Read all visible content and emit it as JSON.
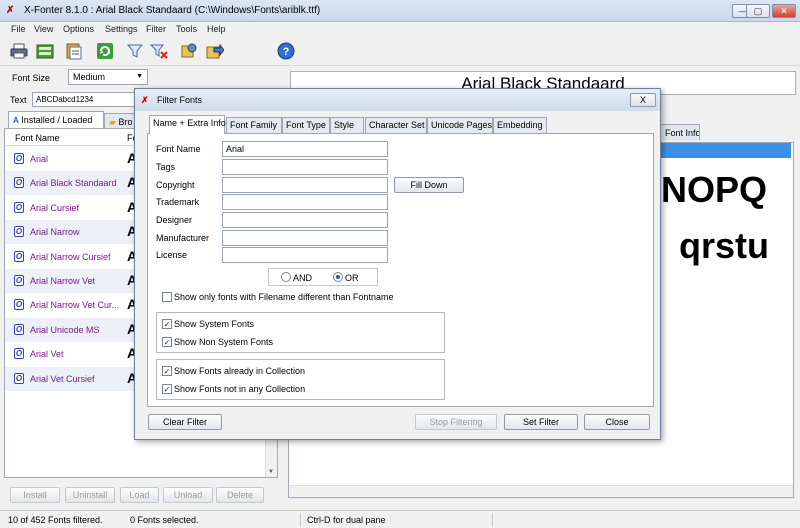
{
  "window": {
    "title": "X-Fonter 8.1.0  :  Arial Black Standaard (C:\\Windows\\Fonts\\ariblk.ttf)",
    "app_icon": "xfonter-logo-icon",
    "min_icon": "minimize-icon",
    "max_icon": "maximize-icon",
    "close_icon": "close-icon"
  },
  "menu": [
    "File",
    "View",
    "Options",
    "Settings",
    "Filter",
    "Tools",
    "Help"
  ],
  "toolbar": {
    "icons": [
      "printer-icon",
      "collection-icon",
      "clipboard-icon",
      "refresh-icon",
      "filter-icon",
      "clear-filter-icon",
      "install-icon",
      "export-icon",
      "help-icon"
    ]
  },
  "left": {
    "font_size_label": "Font Size",
    "font_size_value": "Medium",
    "text_label": "Text",
    "text_value": "ABCDabcd1234",
    "tabs": [
      "Installed / Loaded",
      "Bro"
    ],
    "column_headers": [
      "Font Name",
      "Fo"
    ],
    "fonts": [
      {
        "name": "Arial",
        "preview": "A"
      },
      {
        "name": "Arial Black Standaard",
        "preview": "A"
      },
      {
        "name": "Arial Cursief",
        "preview": "A"
      },
      {
        "name": "Arial Narrow",
        "preview": "A"
      },
      {
        "name": "Arial Narrow Cursief",
        "preview": "A"
      },
      {
        "name": "Arial Narrow Vet",
        "preview": "A"
      },
      {
        "name": "Arial Narrow Vet Cur...",
        "preview": "A"
      },
      {
        "name": "Arial Unicode MS",
        "preview": "A"
      },
      {
        "name": "Arial Vet",
        "preview": "A"
      },
      {
        "name": "Arial Vet Cursief",
        "preview": "A"
      }
    ],
    "buttons": [
      "Install",
      "Uninstall",
      "Load",
      "Unload",
      "Delete"
    ]
  },
  "right": {
    "preview_title": "Arial Black Standaard",
    "tab_font_info": "Font Info",
    "preview_line1": "NOPQ",
    "preview_line2": "qrstu"
  },
  "status": {
    "filtered": "10 of 452 Fonts filtered.",
    "selected": "0 Fonts selected.",
    "hint": "Ctrl-D for dual pane"
  },
  "dialog": {
    "title": "Filter Fonts",
    "close_label": "X",
    "tabs": [
      "Name + Extra Info",
      "Font Family",
      "Font Type",
      "Style",
      "Character Set",
      "Unicode Pages",
      "Embedding"
    ],
    "fields": [
      {
        "label": "Font Name",
        "value": "Arial"
      },
      {
        "label": "Tags",
        "value": ""
      },
      {
        "label": "Copyright",
        "value": ""
      },
      {
        "label": "Trademark",
        "value": ""
      },
      {
        "label": "Designer",
        "value": ""
      },
      {
        "label": "Manufacturer",
        "value": ""
      },
      {
        "label": "License",
        "value": ""
      }
    ],
    "fill_down": "Fill Down",
    "radio_and": "AND",
    "radio_or": "OR",
    "radio_selected": "OR",
    "cb_filename": {
      "label": "Show only fonts with Filename different than Fontname",
      "checked": false
    },
    "cb_system": {
      "label": "Show System Fonts",
      "checked": true
    },
    "cb_nonsystem": {
      "label": "Show Non System Fonts",
      "checked": true
    },
    "cb_collection": {
      "label": "Show Fonts already in Collection",
      "checked": true
    },
    "cb_notcollection": {
      "label": "Show Fonts not in any Collection",
      "checked": true
    },
    "buttons": {
      "clear": "Clear Filter",
      "stop": "Stop Filtering",
      "set": "Set Filter",
      "close": "Close"
    }
  }
}
